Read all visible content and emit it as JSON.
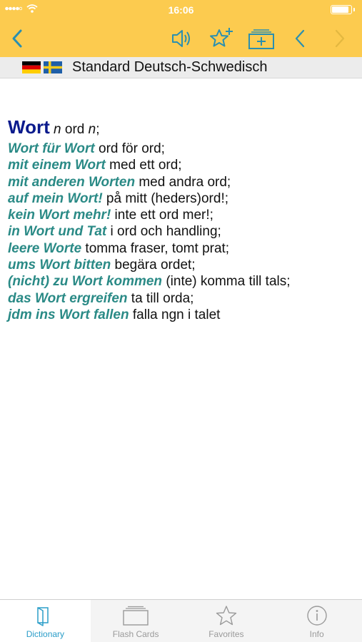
{
  "status": {
    "time": "16:06",
    "battery_level": 0.9
  },
  "colors": {
    "accent_yellow": "#fccb4f",
    "icon_teal": "#2a8fb0",
    "headword": "#0a1a8c",
    "phrase": "#2a8a86",
    "tab_active": "#2a9dc8"
  },
  "toolbar": {
    "back_icon": "chevron-left-icon",
    "speaker_icon": "speaker-icon",
    "favorite_add_icon": "star-plus-icon",
    "flashcard_add_icon": "cards-plus-icon",
    "prev_icon": "chevron-left-icon",
    "next_icon": "chevron-right-icon"
  },
  "dictionary": {
    "title": "Standard Deutsch-Schwedisch",
    "source_flag": "german-flag",
    "target_flag": "swedish-flag"
  },
  "entry": {
    "headword": "Wort",
    "gram1": "n",
    "translation": " ord ",
    "gram2": "n",
    "end": ";",
    "phrases": [
      {
        "de": "Wort für Wort",
        "sv": " ord för ord;"
      },
      {
        "de": "mit einem Wort",
        "sv": " med ett ord;"
      },
      {
        "de": "mit anderen Worten",
        "sv": " med andra ord;"
      },
      {
        "de": "auf mein Wort!",
        "sv": " på mitt (heders)ord!;"
      },
      {
        "de": "kein Wort mehr!",
        "sv": " inte ett ord mer!;"
      },
      {
        "de": "in Wort und Tat",
        "sv": " i ord och handling;"
      },
      {
        "de": "leere Worte",
        "sv": " tomma fraser, tomt prat;"
      },
      {
        "de": "ums Wort bitten",
        "sv": " begära ordet;"
      },
      {
        "de": "(nicht) zu Wort kommen",
        "sv": " (inte) komma till tals;"
      },
      {
        "de": "das Wort ergreifen",
        "sv": " ta till orda;"
      },
      {
        "de": "jdm ins Wort fallen",
        "sv": " falla ngn i talet"
      }
    ]
  },
  "tabs": [
    {
      "label": "Dictionary",
      "icon": "book-icon",
      "active": true
    },
    {
      "label": "Flash Cards",
      "icon": "cards-icon",
      "active": false
    },
    {
      "label": "Favorites",
      "icon": "star-icon",
      "active": false
    },
    {
      "label": "Info",
      "icon": "info-icon",
      "active": false
    }
  ]
}
